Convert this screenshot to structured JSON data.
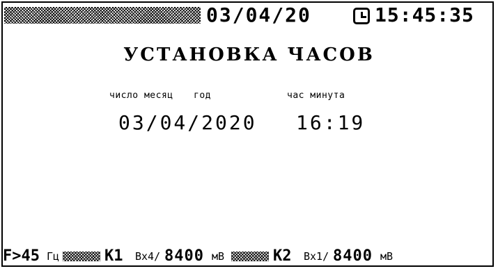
{
  "header": {
    "date": "03/04/20",
    "time": "15:45:35"
  },
  "screen": {
    "title": "УСТАНОВКА ЧАСОВ",
    "labels": {
      "day_month": "число месяц",
      "year": "год",
      "hour_minute": "час минута"
    },
    "values": {
      "date": "03/04/2020",
      "time": "16:19"
    }
  },
  "status_bar": {
    "freq_prefix": "F>45",
    "freq_unit": "Гц",
    "k1_label": "К1",
    "k1_input": "Вх4/",
    "k1_value": "8400",
    "k1_unit": "мВ",
    "k2_label": "К2",
    "k2_input": "Вх1/",
    "k2_value": "8400",
    "k2_unit": "мВ"
  }
}
